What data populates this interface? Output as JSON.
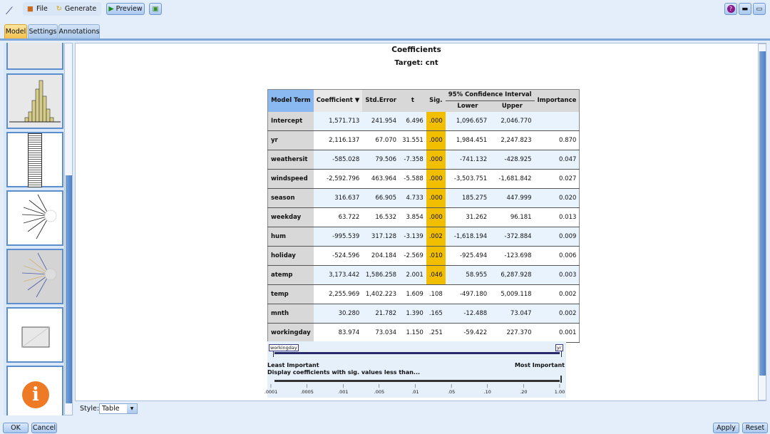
{
  "toolbar": {
    "file": "File",
    "generate": "Generate",
    "preview": "Preview"
  },
  "window_buttons": {
    "help": "?"
  },
  "tabs": [
    "Model",
    "Settings",
    "Annotations"
  ],
  "main": {
    "title": "Coefficients",
    "subtitle": "Target: cnt"
  },
  "table": {
    "headers": {
      "term": "Model Term",
      "coef": "Coefficient ▼",
      "se": "Std.Error",
      "t": "t",
      "sig": "Sig.",
      "ci": "95% Confidence Interval",
      "lower": "Lower",
      "upper": "Upper",
      "importance": "Importance"
    },
    "rows": [
      {
        "term": "Intercept",
        "coef": "1,571.713",
        "se": "241.954",
        "t": "6.496",
        "sig": ".000",
        "lower": "1,096.657",
        "upper": "2,046.770",
        "imp": "",
        "hl": true
      },
      {
        "term": "yr",
        "coef": "2,116.137",
        "se": "67.070",
        "t": "31.551",
        "sig": ".000",
        "lower": "1,984.451",
        "upper": "2,247.823",
        "imp": "0.870",
        "hl": true
      },
      {
        "term": "weathersit",
        "coef": "-585.028",
        "se": "79.506",
        "t": "-7.358",
        "sig": ".000",
        "lower": "-741.132",
        "upper": "-428.925",
        "imp": "0.047",
        "hl": true
      },
      {
        "term": "windspeed",
        "coef": "-2,592.796",
        "se": "463.964",
        "t": "-5.588",
        "sig": ".000",
        "lower": "-3,503.751",
        "upper": "-1,681.842",
        "imp": "0.027",
        "hl": true
      },
      {
        "term": "season",
        "coef": "316.637",
        "se": "66.905",
        "t": "4.733",
        "sig": ".000",
        "lower": "185.275",
        "upper": "447.999",
        "imp": "0.020",
        "hl": true
      },
      {
        "term": "weekday",
        "coef": "63.722",
        "se": "16.532",
        "t": "3.854",
        "sig": ".000",
        "lower": "31.262",
        "upper": "96.181",
        "imp": "0.013",
        "hl": true
      },
      {
        "term": "hum",
        "coef": "-995.539",
        "se": "317.128",
        "t": "-3.139",
        "sig": ".002",
        "lower": "-1,618.194",
        "upper": "-372.884",
        "imp": "0.009",
        "hl": true
      },
      {
        "term": "holiday",
        "coef": "-524.596",
        "se": "204.184",
        "t": "-2.569",
        "sig": ".010",
        "lower": "-925.494",
        "upper": "-123.698",
        "imp": "0.006",
        "hl": true
      },
      {
        "term": "atemp",
        "coef": "3,173.442",
        "se": "1,586.258",
        "t": "2.001",
        "sig": ".046",
        "lower": "58.955",
        "upper": "6,287.928",
        "imp": "0.003",
        "hl": true
      },
      {
        "term": "temp",
        "coef": "2,255.969",
        "se": "1,402.223",
        "t": "1.609",
        "sig": ".108",
        "lower": "-497.180",
        "upper": "5,009.118",
        "imp": "0.002",
        "hl": false
      },
      {
        "term": "mnth",
        "coef": "30.280",
        "se": "21.782",
        "t": "1.390",
        "sig": ".165",
        "lower": "-12.488",
        "upper": "73.047",
        "imp": "0.002",
        "hl": false
      },
      {
        "term": "workingday",
        "coef": "83.974",
        "se": "73.034",
        "t": "1.150",
        "sig": ".251",
        "lower": "-59.422",
        "upper": "227.370",
        "imp": "0.001",
        "hl": false
      }
    ]
  },
  "importance_slider": {
    "min_label": "workingday",
    "max_label": "yr",
    "least": "Least Important",
    "most": "Most Important"
  },
  "sig_slider": {
    "label": "Display coefficients with sig. values less than...",
    "ticks": [
      ".0001",
      ".0005",
      ".001",
      ".005",
      ".01",
      ".05",
      ".10",
      ".20",
      "1.00"
    ],
    "value": "1.00"
  },
  "style": {
    "label": "Style:",
    "value": "Table"
  },
  "footer": {
    "ok": "OK",
    "cancel": "Cancel",
    "apply": "Apply",
    "reset": "Reset"
  },
  "colors": {
    "highlight": "#f2be00",
    "active_tab": "#f3c04c"
  }
}
